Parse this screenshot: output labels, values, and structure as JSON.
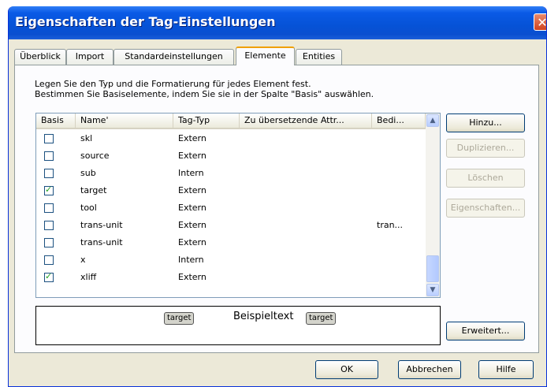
{
  "window": {
    "title": "Eigenschaften der Tag-Einstellungen"
  },
  "tabs": [
    {
      "label": "Überblick"
    },
    {
      "label": "Import"
    },
    {
      "label": "Standardeinstellungen"
    },
    {
      "label": "Elemente"
    },
    {
      "label": "Entities"
    }
  ],
  "description": {
    "line1": "Legen Sie den Typ und die Formatierung für jedes Element fest.",
    "line2": "Bestimmen Sie Basiselemente, indem Sie sie in der Spalte \"Basis\" auswählen."
  },
  "table": {
    "columns": [
      "Basis",
      "Name'",
      "Tag-Typ",
      "Zu übersetzende Attr...",
      "Bedi..."
    ],
    "rows": [
      {
        "checked": false,
        "name": "skl",
        "type": "Extern",
        "attrs": "",
        "cond": ""
      },
      {
        "checked": false,
        "name": "source",
        "type": "Extern",
        "attrs": "",
        "cond": ""
      },
      {
        "checked": false,
        "name": "sub",
        "type": "Intern",
        "attrs": "",
        "cond": ""
      },
      {
        "checked": true,
        "name": "target",
        "type": "Extern",
        "attrs": "",
        "cond": ""
      },
      {
        "checked": false,
        "name": "tool",
        "type": "Extern",
        "attrs": "",
        "cond": ""
      },
      {
        "checked": false,
        "name": "trans-unit",
        "type": "Extern",
        "attrs": "",
        "cond": "tran..."
      },
      {
        "checked": false,
        "name": "trans-unit",
        "type": "Extern",
        "attrs": "",
        "cond": ""
      },
      {
        "checked": false,
        "name": "x",
        "type": "Intern",
        "attrs": "",
        "cond": ""
      },
      {
        "checked": true,
        "name": "xliff",
        "type": "Extern",
        "attrs": "",
        "cond": ""
      }
    ]
  },
  "preview": {
    "open_tag": "target",
    "sample_text": "Beispieltext",
    "close_tag": "target"
  },
  "side_buttons": {
    "add": "Hinzu...",
    "duplicate": "Duplizieren...",
    "delete": "Löschen",
    "properties": "Eigenschaften...",
    "advanced": "Erweitert..."
  },
  "footer_buttons": {
    "ok": "OK",
    "cancel": "Abbrechen",
    "help": "Hilfe"
  },
  "colors": {
    "title_bar": "#0a5ae6",
    "active_tab_accent": "#f0a000",
    "checkbox_check": "#21a121"
  }
}
